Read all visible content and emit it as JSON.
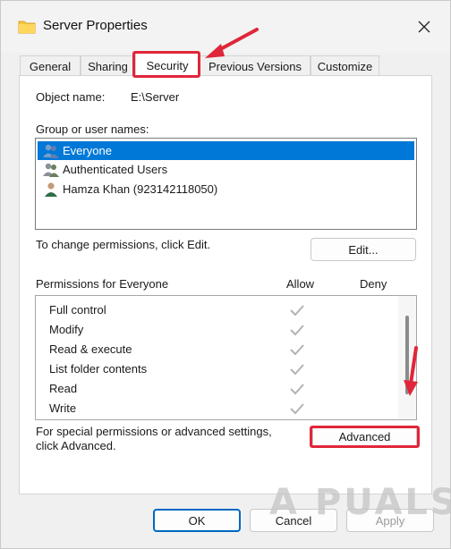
{
  "window": {
    "title": "Server Properties"
  },
  "tabs": [
    {
      "label": "General"
    },
    {
      "label": "Sharing"
    },
    {
      "label": "Security"
    },
    {
      "label": "Previous Versions"
    },
    {
      "label": "Customize"
    }
  ],
  "security": {
    "object_name_label": "Object name:",
    "object_name_value": "E:\\Server",
    "group_label": "Group or user names:",
    "users": [
      {
        "name": "Everyone",
        "icon": "users-group-icon"
      },
      {
        "name": "Authenticated Users",
        "icon": "users-group-icon"
      },
      {
        "name": "Hamza Khan (923142118050)",
        "icon": "user-avatar-icon"
      }
    ],
    "change_text": "To change permissions, click Edit.",
    "edit_label": "Edit...",
    "permissions_for": "Permissions for Everyone",
    "allow_header": "Allow",
    "deny_header": "Deny",
    "permissions": [
      {
        "name": "Full control",
        "allow": true
      },
      {
        "name": "Modify",
        "allow": true
      },
      {
        "name": "Read & execute",
        "allow": true
      },
      {
        "name": "List folder contents",
        "allow": true
      },
      {
        "name": "Read",
        "allow": true
      },
      {
        "name": "Write",
        "allow": true
      }
    ],
    "special_line1": "For special permissions or advanced settings,",
    "special_line2": "click Advanced.",
    "advanced_label": "Advanced"
  },
  "footer": {
    "ok_label": "OK",
    "cancel_label": "Cancel",
    "apply_label": "Apply"
  },
  "watermark": {
    "text": "A PUALS"
  },
  "colors": {
    "selection": "#0078d7",
    "highlight": "#e0263a"
  }
}
